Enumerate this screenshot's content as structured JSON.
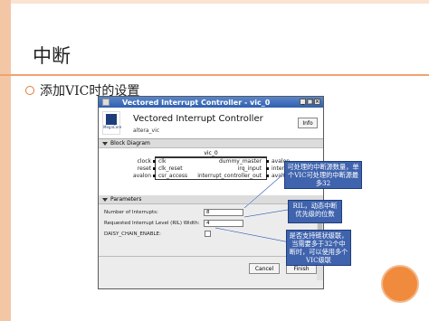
{
  "slide": {
    "title": "中断",
    "bullet": "添加VIC时的设置"
  },
  "dialog": {
    "title": "Vectored Interrupt Controller - vic_0",
    "header_title": "Vectored Interrupt Controller",
    "header_subtitle": "altera_vic",
    "info_button": "Info",
    "logo_text": "MegaCore",
    "block_section": "Block Diagram",
    "block_name": "vic_0",
    "left_ports": [
      "clock",
      "reset",
      "avalon"
    ],
    "inner_left": [
      "clk",
      "clk_reset",
      "csr_access"
    ],
    "inner_right": [
      "dummy_master",
      "irq_input",
      "interrupt_controller_out"
    ],
    "right_ports": [
      "avalon",
      "interrupt",
      "avalon"
    ],
    "params_section": "Parameters",
    "params": [
      {
        "label": "Number of Interrupts:",
        "value": "8"
      },
      {
        "label": "Requested Interrupt Level (RIL) Width:",
        "value": "4"
      },
      {
        "label": "DAISY_CHAIN_ENABLE:",
        "value": ""
      }
    ],
    "cancel_button": "Cancel",
    "finish_button": "Finish"
  },
  "callouts": [
    "可处理的中断源数量，单个VIC可处理的中断源最多32",
    "RIL，动态中断优先级的位数",
    "是否支持链状级联，当需要多于32个中断时，可以使用多个VIC级联"
  ],
  "colors": {
    "accent": "#f08a3d",
    "callout": "#3f63ad",
    "titlebar": "#2f5fae"
  }
}
